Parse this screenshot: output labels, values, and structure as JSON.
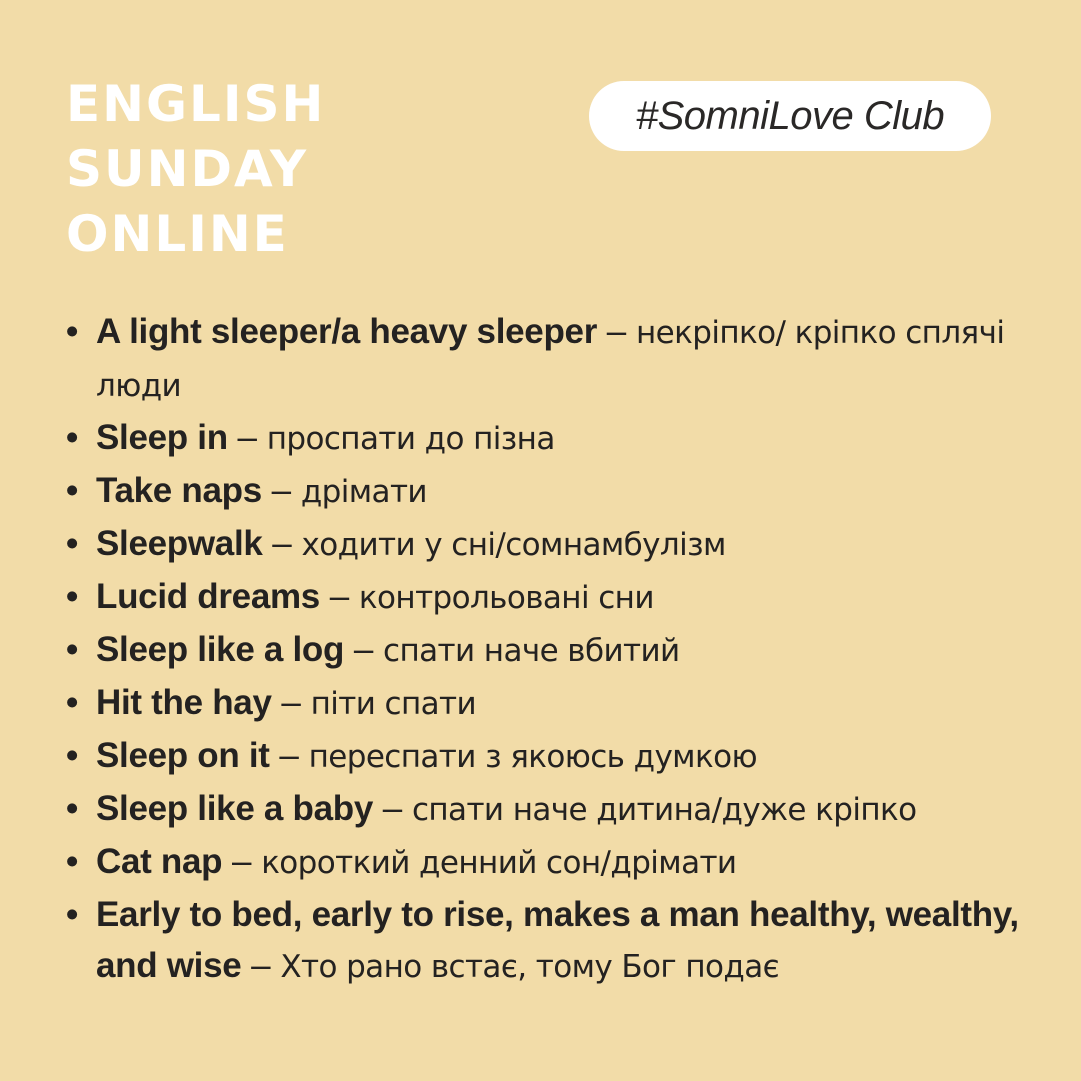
{
  "title": {
    "lines": [
      "ENGLISH",
      "SUNDAY",
      "ONLINE"
    ]
  },
  "hashtag": "#SomniLove Club",
  "phrases": [
    {
      "term": "A light sleeper/a heavy sleeper",
      "meaning": "некріпко/ кріпко сплячі люди"
    },
    {
      "term": "Sleep in",
      "meaning": "проспати до пізна"
    },
    {
      "term": "Take naps",
      "meaning": "дрімати"
    },
    {
      "term": "Sleepwalk",
      "meaning": "ходити у сні/сомнамбулізм"
    },
    {
      "term": "Lucid dreams",
      "meaning": "контрольовані сни"
    },
    {
      "term": "Sleep like a log",
      "meaning": "спати наче вбитий"
    },
    {
      "term": "Hit the hay",
      "meaning": "піти спати"
    },
    {
      "term": "Sleep on it",
      "meaning": "переспати з якоюсь думкою"
    },
    {
      "term": "Sleep like a baby",
      "meaning": "спати наче дитина/дуже кріпко"
    },
    {
      "term": "Cat nap",
      "meaning": "короткий денний сон/дрімати"
    },
    {
      "term": "Early to bed, early to rise, makes a man healthy, wealthy, and wise",
      "meaning": "Хто рано встає, тому Бог подає"
    }
  ],
  "separator": "–",
  "bullet": "•",
  "colors": {
    "background": "#f2dca8",
    "title": "#ffffff",
    "text": "#242221",
    "pill": "#ffffff"
  }
}
